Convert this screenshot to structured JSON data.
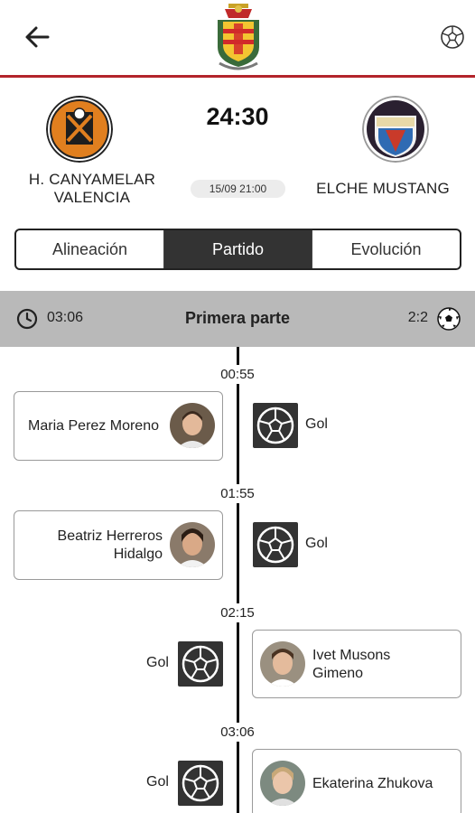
{
  "header": {
    "back_icon": "arrow-left-icon",
    "crest_icon": "club-crest-icon",
    "ball_icon": "soccer-ball-icon",
    "accent_color": "#b3242b"
  },
  "match": {
    "home_team": "H. CANYAMELAR VALENCIA",
    "away_team": "ELCHE MUSTANG",
    "score": "24:30",
    "datetime": "15/09 21:00"
  },
  "tabs": [
    {
      "label": "Alineación",
      "active": false
    },
    {
      "label": "Partido",
      "active": true
    },
    {
      "label": "Evolución",
      "active": false
    }
  ],
  "period": {
    "time": "03:06",
    "title": "Primera parte",
    "score": "2:2"
  },
  "events": [
    {
      "minute": "00:55",
      "side": "home",
      "player": "Maria Perez Moreno",
      "event": "Gol"
    },
    {
      "minute": "01:55",
      "side": "home",
      "player_line1": "Beatriz Herreros",
      "player_line2": "Hidalgo",
      "event": "Gol"
    },
    {
      "minute": "02:15",
      "side": "away",
      "player_line1": "Ivet Musons",
      "player_line2": "Gimeno",
      "event": "Gol"
    },
    {
      "minute": "03:06",
      "side": "away",
      "player": "Ekaterina Zhukova",
      "event": "Gol"
    }
  ]
}
